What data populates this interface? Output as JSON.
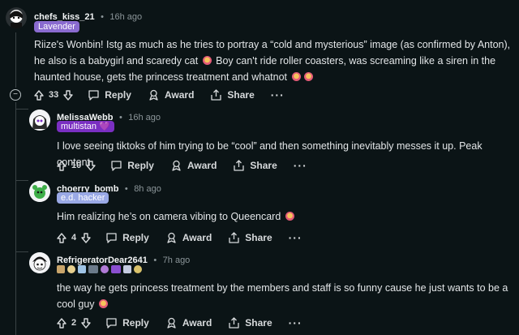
{
  "comments": [
    {
      "username": "chefs_kiss_21",
      "time": "16h ago",
      "flair": "Lavender",
      "text_parts": [
        "Riize's Wonbin! Istg as much as he tries to portray a “cold and mysterious” image (as confirmed by Anton), he also is a babygirl and scaredy cat ",
        " Boy can't ride roller coasters, was screaming like a siren in the haunted house, gets the princess treatment and whatnot "
      ],
      "votes": "33"
    },
    {
      "username": "MelissaWebb",
      "time": "16h ago",
      "flair": "multistan 💜",
      "text": "I love seeing tiktoks of him trying to be “cool” and then something inevitably messes it up. Peak content",
      "votes": "10"
    },
    {
      "username": "choerry_bomb",
      "time": "8h ago",
      "flair": "e.d. hacker",
      "text": "Him realizing he’s on camera vibing to Queencard ",
      "votes": "4"
    },
    {
      "username": "RefrigeratorDear2641",
      "time": "7h ago",
      "text": "the way he gets princess treatment by the members and staff is so funny cause he just wants to be a cool guy ",
      "votes": "2"
    }
  ],
  "actions": {
    "reply": "Reply",
    "award": "Award",
    "share": "Share",
    "more": "···"
  },
  "dot": "•",
  "collapse_symbol": "−",
  "colors": {
    "background": "#0b1416",
    "flair_lavender": "#8a6bd0",
    "flair_multistan": "#7a2fc2",
    "flair_edhacker": "#9aa9e6"
  }
}
